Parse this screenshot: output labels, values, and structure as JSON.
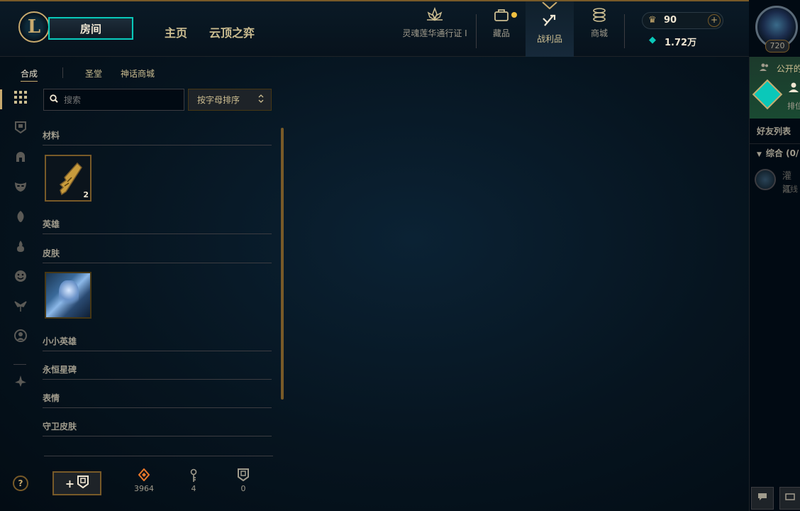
{
  "topbar": {
    "logo_letter": "L",
    "play_label": "房间",
    "nav": [
      {
        "label": "主页"
      },
      {
        "label": "云顶之弈"
      }
    ],
    "icon_nav": [
      {
        "label": "灵魂莲华通行证 I",
        "icon": "lotus-icon"
      },
      {
        "label": "藏品",
        "icon": "collection-icon"
      },
      {
        "label": "战利品",
        "icon": "loot-icon"
      },
      {
        "label": "商城",
        "icon": "store-icon"
      }
    ],
    "wallet": {
      "blue_essence": "90",
      "riot_points": "1.72万"
    },
    "level": "720"
  },
  "subtabs": [
    "合成",
    "圣堂",
    "神话商城"
  ],
  "search": {
    "placeholder": "搜索"
  },
  "sort": {
    "label": "按字母排序"
  },
  "categories": {
    "materials": "材料",
    "champions": "英雄",
    "skins": "皮肤",
    "little_legends": "小小英雄",
    "eternals": "永恒星碑",
    "emotes": "表情",
    "ward_skins": "守卫皮肤"
  },
  "materials_items": [
    {
      "name": "hextech-key-fragment",
      "count": "2"
    }
  ],
  "skins_items": [
    {
      "name": "skin-shard"
    }
  ],
  "left_nav_icons": [
    "grid-icon",
    "chest-icon",
    "helmet-icon",
    "mask-icon",
    "summoner-icon",
    "flame-icon",
    "emote-icon",
    "ward-icon",
    "profile-icon",
    "eternal-icon"
  ],
  "bottom": {
    "help": "?",
    "add_chest": "+",
    "currencies": [
      {
        "icon": "orange-essence-icon",
        "value": "3964"
      },
      {
        "icon": "key-icon",
        "value": "4"
      },
      {
        "icon": "chest-icon",
        "value": "0"
      }
    ]
  },
  "social": {
    "open_label": "公开的",
    "rank_label": "排位",
    "friends_header": "好友列表",
    "group_label": "综合 (0/",
    "friend_name": "灌江",
    "friend_status": "离线"
  },
  "colors": {
    "gold": "#c8aa6e",
    "teal": "#0ac8b9",
    "bg": "#010a13",
    "text": "#a09b8c"
  }
}
